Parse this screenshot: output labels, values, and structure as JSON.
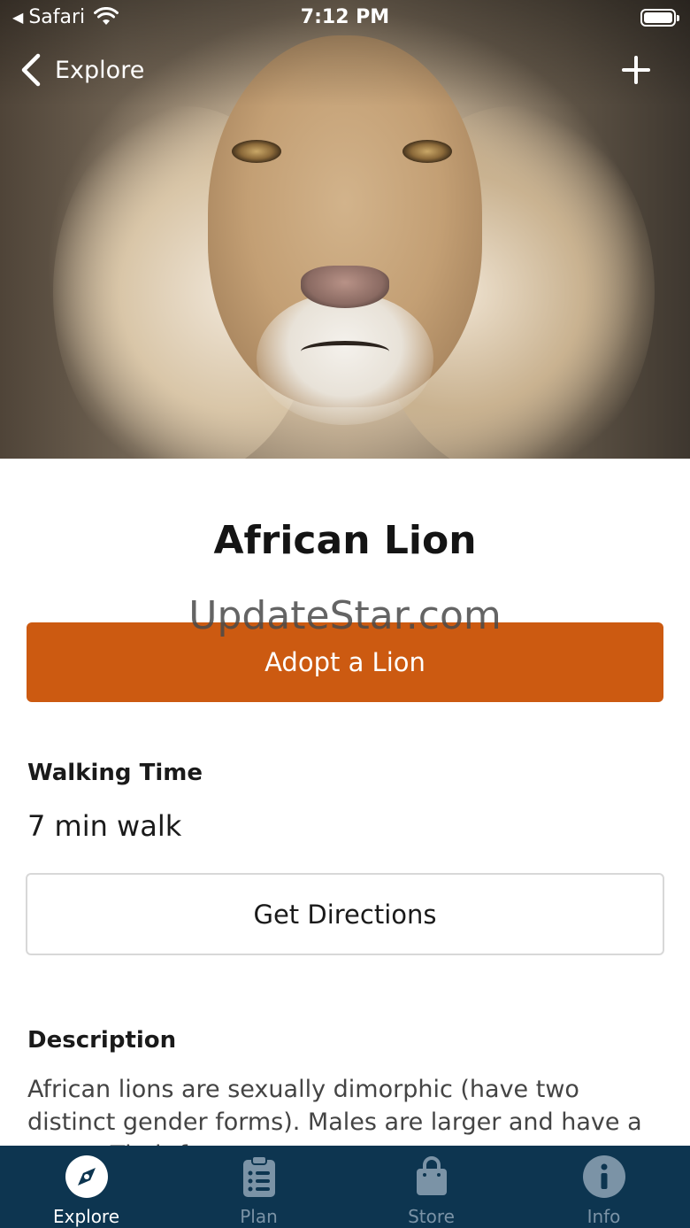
{
  "status_bar": {
    "back_app": "Safari",
    "time": "7:12 PM"
  },
  "nav": {
    "back_label": "Explore"
  },
  "hero": {
    "subject": "lion-photo"
  },
  "watermark": "UpdateStar.com",
  "animal": {
    "name": "African Lion"
  },
  "actions": {
    "adopt_label": "Adopt a Lion",
    "directions_label": "Get Directions"
  },
  "walking": {
    "heading": "Walking Time",
    "value": "7 min walk"
  },
  "description": {
    "heading": "Description",
    "text": "African lions are sexually dimorphic (have two distinct gender forms). Males are larger and have a mane. Their fur"
  },
  "tabbar": {
    "items": [
      {
        "label": "Explore",
        "icon": "compass-icon",
        "active": true
      },
      {
        "label": "Plan",
        "icon": "clipboard-list-icon",
        "active": false
      },
      {
        "label": "Store",
        "icon": "shopping-bag-icon",
        "active": false
      },
      {
        "label": "Info",
        "icon": "info-icon",
        "active": false
      }
    ]
  },
  "colors": {
    "accent": "#cc5a11",
    "tabbar_bg": "#0d3550",
    "tab_inactive": "#7b93a6"
  }
}
